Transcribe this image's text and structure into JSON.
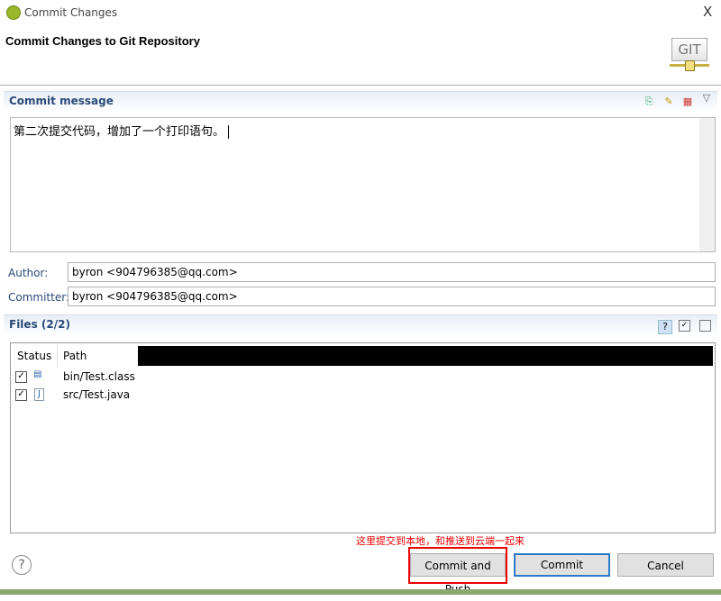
{
  "window": {
    "title": "Commit Changes",
    "close": "X"
  },
  "header": {
    "title": "Commit Changes to Git Repository",
    "logo_text": "GIT"
  },
  "commit_message": {
    "section_title": "Commit message",
    "text": "第二次提交代码，增加了一个打印语句。"
  },
  "author": {
    "label": "Author:",
    "value": "byron <904796385@qq.com>"
  },
  "committer": {
    "label": "Committer:",
    "value": "byron <904796385@qq.com>"
  },
  "files": {
    "section_title": "Files (2/2)",
    "columns": [
      "Status",
      "Path"
    ],
    "rows": [
      {
        "checked": true,
        "icon": "class-file-icon",
        "path": "bin/Test.class"
      },
      {
        "checked": true,
        "icon": "java-file-icon",
        "path": "src/Test.java"
      }
    ]
  },
  "annotation": {
    "text": "这里提交到本地，和推送到云端一起来",
    "color": "#ee0000"
  },
  "buttons": {
    "help": "?",
    "commit_and_push": "Commit and Push",
    "commit": "Commit",
    "cancel": "Cancel"
  }
}
